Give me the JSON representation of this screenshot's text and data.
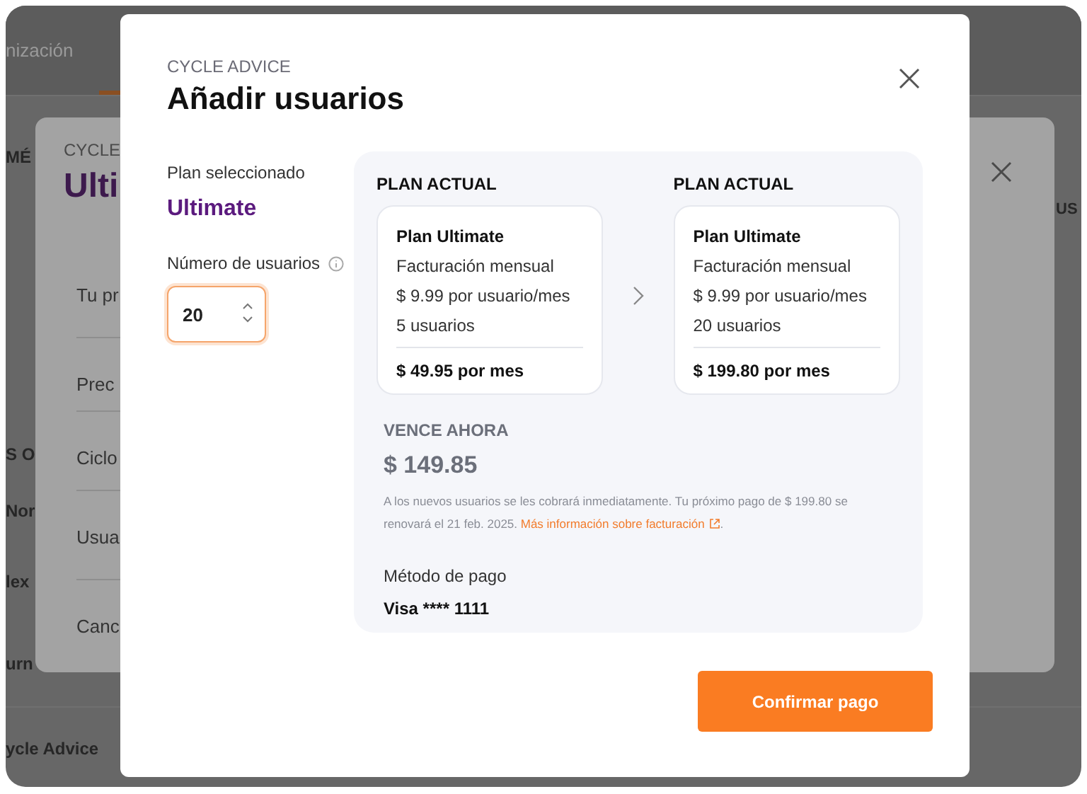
{
  "background": {
    "tab": "nización",
    "labels": [
      "MÉ",
      "S O",
      "Nor",
      "lex",
      "urn",
      "ycle Advice"
    ],
    "dialog": {
      "eyebrow": "CYCLE",
      "title": "Ulti",
      "rows": [
        "Tu pr",
        "Prec",
        "Ciclo",
        "Usua",
        "Canc"
      ],
      "side_label": "US"
    }
  },
  "dialog": {
    "eyebrow": "CYCLE ADVICE",
    "title": "Añadir usuarios",
    "plan_label": "Plan seleccionado",
    "plan_name": "Ultimate",
    "users_label": "Número de usuarios",
    "users_value": "20",
    "plans": [
      {
        "heading": "PLAN ACTUAL",
        "name": "Plan Ultimate",
        "billing": "Facturación mensual",
        "price": "$ 9.99 por usuario/mes",
        "users": "5 usuarios",
        "total": "$ 49.95 por mes"
      },
      {
        "heading": "PLAN ACTUAL",
        "name": "Plan Ultimate",
        "billing": "Facturación mensual",
        "price": "$ 9.99 por usuario/mes",
        "users": "20 usuarios",
        "total": "$ 199.80 por mes"
      }
    ],
    "due_label": "VENCE AHORA",
    "due_amount": "$ 149.85",
    "note": "A los nuevos usuarios se les cobrará inmediatamente. Tu próximo pago de $ 199.80 se renovará el 21 feb. 2025.",
    "note_link": "Más información sobre facturación",
    "note_end": ".",
    "payment_label": "Método de pago",
    "payment_value": "Visa **** 1111",
    "confirm_button": "Confirmar pago"
  }
}
